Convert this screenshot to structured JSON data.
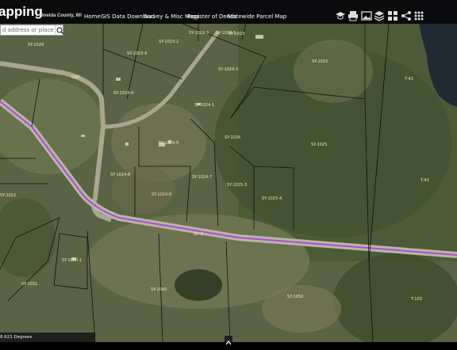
{
  "header": {
    "app_title": "apping",
    "county": "Oneida County, WI",
    "nav": [
      "Home",
      "GIS Data Download",
      "Survey & Misc Maps",
      "Register of Deeds",
      "Statewide Parcel Map"
    ]
  },
  "search": {
    "placeholder": "d address or place"
  },
  "status": {
    "coords": "8.621 Degrees"
  },
  "parcels": [
    "SY-1029",
    "SY-1029-3",
    "SY-1029-1",
    "SY-1023",
    "SY-1022",
    "SY-1023-2",
    "SY-1023-4",
    "GAP",
    "SY-1024-4",
    "SY-1024-3",
    "SY-1024-1",
    "SY-1024-5",
    "SY-1024-8",
    "SY-1024-7",
    "SY-1026",
    "SY-1025",
    "SY-1025-3",
    "SY-1025-4",
    "SY-1024-6",
    "SY-1022",
    "SY-1030-1",
    "SY-1031",
    "SY-1040",
    "SY-1050",
    "T-43",
    "T-43",
    "T-103"
  ],
  "road_label": "SH-8",
  "colors": {
    "route": "#b04ad8",
    "parcel_line": "#111111",
    "label": "#f4e9b0",
    "header_bg": "#0b0b0d"
  },
  "icons": [
    "graduation-cap-icon",
    "print-icon",
    "image-icon",
    "layers-icon",
    "grid-icon",
    "share-icon",
    "dots-icon"
  ]
}
